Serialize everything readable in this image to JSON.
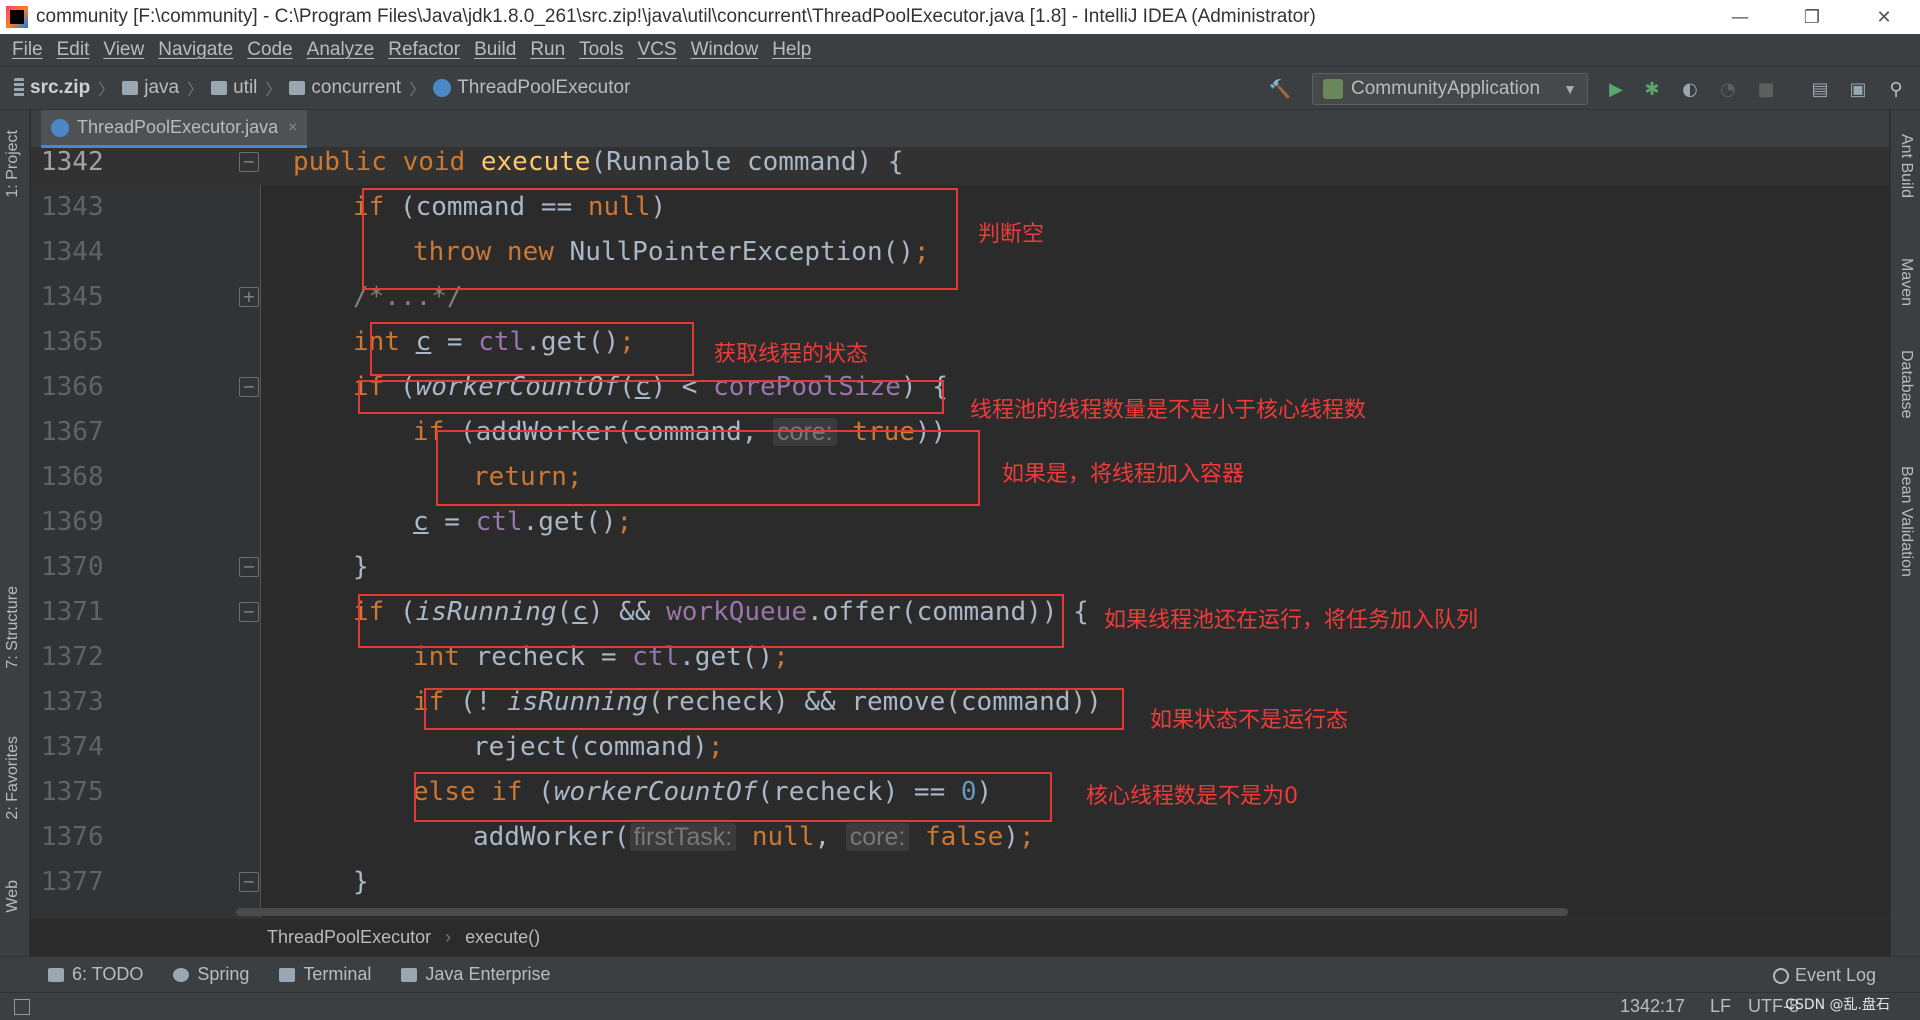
{
  "window": {
    "title": "community [F:\\community] - C:\\Program Files\\Java\\jdk1.8.0_261\\src.zip!\\java\\util\\concurrent\\ThreadPoolExecutor.java [1.8] - IntelliJ IDEA (Administrator)",
    "minimize": "—",
    "restore": "❐",
    "close": "✕"
  },
  "menu": [
    "File",
    "Edit",
    "View",
    "Navigate",
    "Code",
    "Analyze",
    "Refactor",
    "Build",
    "Run",
    "Tools",
    "VCS",
    "Window",
    "Help"
  ],
  "navbar": {
    "crumbs": [
      "src.zip",
      "java",
      "util",
      "concurrent",
      "ThreadPoolExecutor"
    ],
    "run_config": "CommunityApplication"
  },
  "left_tabs": [
    "1: Project",
    "7: Structure",
    "2: Favorites",
    "Web"
  ],
  "right_tabs": [
    "Ant Build",
    "Maven",
    "Database",
    "Bean Validation"
  ],
  "editor_tab": {
    "label": "ThreadPoolExecutor.java",
    "close": "×"
  },
  "gutter_icon_labels": {
    "implements": "I",
    "overrides": "O",
    "at": "@"
  },
  "code_lines": [
    {
      "num": "1342",
      "segments": [
        [
          "kw",
          "public "
        ],
        [
          "kw",
          "void "
        ],
        [
          "fn",
          "execute"
        ],
        [
          "",
          "(Runnable command) {"
        ]
      ]
    },
    {
      "num": "1343",
      "segments": [
        [
          "kw",
          "if "
        ],
        [
          "",
          "(command == "
        ],
        [
          "kw",
          "null"
        ],
        [
          "",
          ")"
        ]
      ]
    },
    {
      "num": "1344",
      "segments": [
        [
          "kw",
          "throw new "
        ],
        [
          "",
          "NullPointerException()"
        ],
        [
          "kw",
          ";"
        ]
      ]
    },
    {
      "num": "1345",
      "segments": [
        [
          "cmt",
          "/*...*/"
        ]
      ]
    },
    {
      "num": "1365",
      "segments": [
        [
          "kw",
          "int "
        ],
        [
          "ul",
          "c"
        ],
        [
          "",
          " = "
        ],
        [
          "fld",
          "ctl"
        ],
        [
          "",
          ".get()"
        ],
        [
          "kw",
          ";"
        ]
      ]
    },
    {
      "num": "1366",
      "segments": [
        [
          "kw",
          "if "
        ],
        [
          "",
          "("
        ],
        [
          "it",
          "workerCountOf"
        ],
        [
          "",
          "("
        ],
        [
          "ul",
          "c"
        ],
        [
          "",
          ") < "
        ],
        [
          "fld",
          "corePoolSize"
        ],
        [
          "",
          ") {"
        ]
      ]
    },
    {
      "num": "1367",
      "segments": [
        [
          "kw",
          "if "
        ],
        [
          "",
          "(addWorker(command, "
        ],
        [
          "hint",
          "core:"
        ],
        [
          "kw",
          " true"
        ],
        [
          "",
          "))"
        ]
      ]
    },
    {
      "num": "1368",
      "segments": [
        [
          "kw",
          "return;"
        ]
      ]
    },
    {
      "num": "1369",
      "segments": [
        [
          "ul",
          "c"
        ],
        [
          "",
          " = "
        ],
        [
          "fld",
          "ctl"
        ],
        [
          "",
          ".get()"
        ],
        [
          "kw",
          ";"
        ]
      ]
    },
    {
      "num": "1370",
      "segments": [
        [
          "",
          "}"
        ]
      ]
    },
    {
      "num": "1371",
      "segments": [
        [
          "kw",
          "if "
        ],
        [
          "",
          "("
        ],
        [
          "it",
          "isRunning"
        ],
        [
          "",
          "("
        ],
        [
          "ul",
          "c"
        ],
        [
          "",
          ") && "
        ],
        [
          "fld",
          "workQueue"
        ],
        [
          "",
          ".offer(command)) {"
        ]
      ]
    },
    {
      "num": "1372",
      "segments": [
        [
          "kw",
          "int "
        ],
        [
          "",
          "recheck = "
        ],
        [
          "fld",
          "ctl"
        ],
        [
          "",
          ".get()"
        ],
        [
          "kw",
          ";"
        ]
      ]
    },
    {
      "num": "1373",
      "segments": [
        [
          "kw",
          "if "
        ],
        [
          "",
          "(! "
        ],
        [
          "it",
          "isRunning"
        ],
        [
          "",
          "(recheck) && remove(command))"
        ]
      ]
    },
    {
      "num": "1374",
      "segments": [
        [
          "",
          "reject(command)"
        ],
        [
          "kw",
          ";"
        ]
      ]
    },
    {
      "num": "1375",
      "segments": [
        [
          "kw",
          "else if "
        ],
        [
          "",
          "("
        ],
        [
          "it",
          "workerCountOf"
        ],
        [
          "",
          "(recheck) == "
        ],
        [
          "num",
          "0"
        ],
        [
          "",
          ")"
        ]
      ]
    },
    {
      "num": "1376",
      "segments": [
        [
          "",
          "addWorker("
        ],
        [
          "hint",
          "firstTask:"
        ],
        [
          "kw",
          " null"
        ],
        [
          "",
          ", "
        ],
        [
          "hint",
          "core:"
        ],
        [
          "kw",
          " false"
        ],
        [
          "",
          ")"
        ],
        [
          "kw",
          ";"
        ]
      ]
    },
    {
      "num": "1377",
      "segments": [
        [
          "",
          "}"
        ]
      ]
    }
  ],
  "annotations": [
    "判断空",
    "获取线程的状态",
    "线程池的线程数量是不是小于核心线程数",
    "如果是，将线程加入容器",
    "如果线程池还在运行，将任务加入队列",
    "如果状态不是运行态",
    "核心线程数是不是为0"
  ],
  "editor_breadcrumb": [
    "ThreadPoolExecutor",
    "execute()"
  ],
  "bottom_tools": [
    "6: TODO",
    "Spring",
    "Terminal",
    "Java Enterprise"
  ],
  "event_log": "Event Log",
  "status": {
    "position": "1342:17",
    "line_sep": "LF",
    "encoding": "UTF-8"
  },
  "watermark": "CSDN @乱.盘石",
  "colors": {
    "keyword": "#cc7832",
    "function": "#ffc66d",
    "field": "#9876aa",
    "annotation": "#e53935"
  }
}
